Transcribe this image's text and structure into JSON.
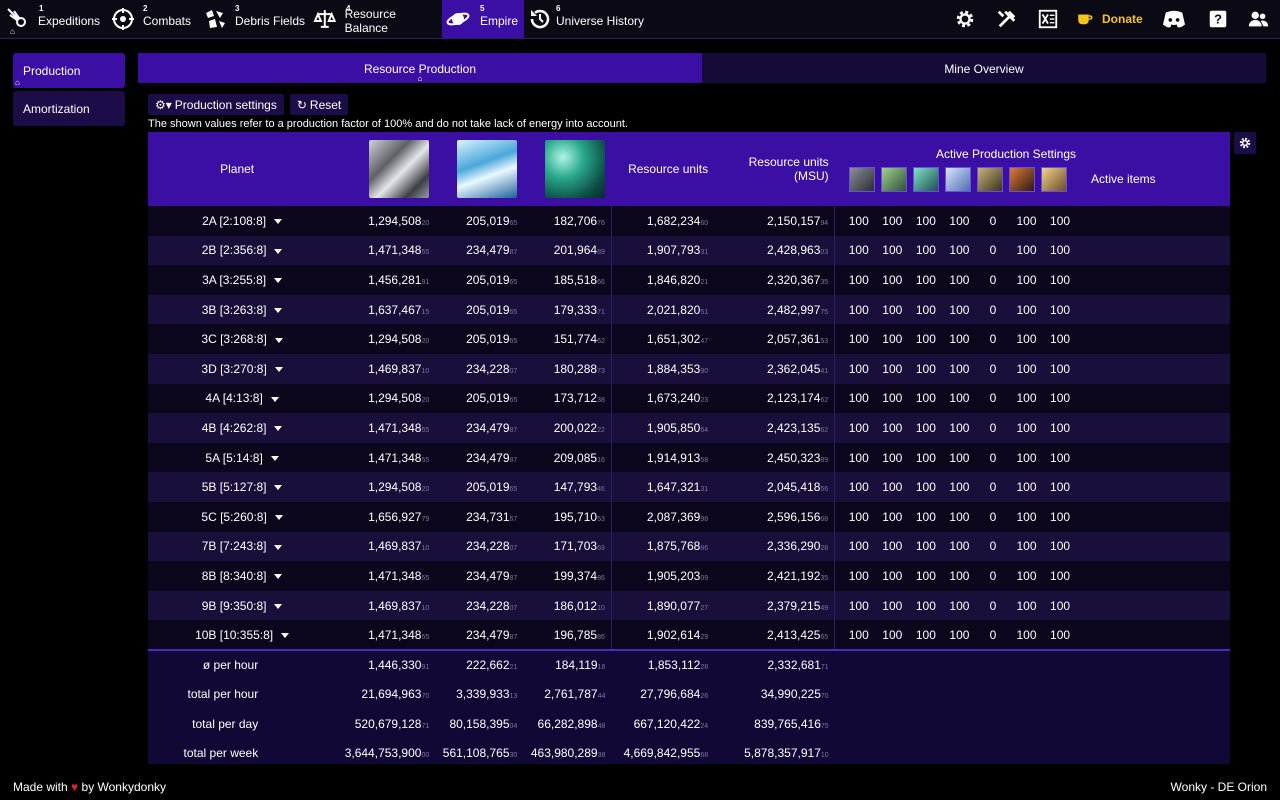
{
  "nav": [
    {
      "num": "1",
      "label": "Expeditions",
      "icon": "comet-icon"
    },
    {
      "num": "2",
      "label": "Combats",
      "icon": "crosshair-icon"
    },
    {
      "num": "3",
      "label": "Debris Fields",
      "icon": "debris-icon"
    },
    {
      "num": "4",
      "label": "Resource Balance",
      "icon": "scale-icon"
    },
    {
      "num": "5",
      "label": "Empire",
      "icon": "planet-icon"
    },
    {
      "num": "6",
      "label": "Universe History",
      "icon": "history-icon"
    }
  ],
  "top_right": {
    "donate_label": "Donate"
  },
  "sidebar": [
    {
      "label": "Production"
    },
    {
      "label": "Amortization"
    }
  ],
  "tabs": [
    {
      "label": "Resource Production"
    },
    {
      "label": "Mine Overview"
    }
  ],
  "toolbar": {
    "settings_label": "Production settings",
    "reset_label": "Reset"
  },
  "note": "The shown values refer to a production factor of 100% and do not take lack of energy into account.",
  "headers": {
    "planet": "Planet",
    "resource_units": "Resource units",
    "resource_units_msu": "Resource units (MSU)",
    "active_production_settings": "Active Production Settings",
    "active_items": "Active items"
  },
  "rows": [
    {
      "planet": "2A [2:108:8]",
      "metal": "1,294,508",
      "metal_dec": "20",
      "crystal": "205,019",
      "crystal_dec": "65",
      "deut": "182,706",
      "deut_dec": "76",
      "ru": "1,682,234",
      "ru_dec": "60",
      "msu": "2,150,157",
      "msu_dec": "94",
      "settings": [
        "100",
        "100",
        "100",
        "100",
        "0",
        "100",
        "100"
      ]
    },
    {
      "planet": "2B [2:356:8]",
      "metal": "1,471,348",
      "metal_dec": "55",
      "crystal": "234,479",
      "crystal_dec": "87",
      "deut": "201,964",
      "deut_dec": "89",
      "ru": "1,907,793",
      "ru_dec": "31",
      "msu": "2,428,963",
      "msu_dec": "03",
      "settings": [
        "100",
        "100",
        "100",
        "100",
        "0",
        "100",
        "100"
      ]
    },
    {
      "planet": "3A [3:255:8]",
      "metal": "1,456,281",
      "metal_dec": "91",
      "crystal": "205,019",
      "crystal_dec": "65",
      "deut": "185,518",
      "deut_dec": "66",
      "ru": "1,846,820",
      "ru_dec": "21",
      "msu": "2,320,367",
      "msu_dec": "35",
      "settings": [
        "100",
        "100",
        "100",
        "100",
        "0",
        "100",
        "100"
      ]
    },
    {
      "planet": "3B [3:263:8]",
      "metal": "1,637,467",
      "metal_dec": "15",
      "crystal": "205,019",
      "crystal_dec": "65",
      "deut": "179,333",
      "deut_dec": "71",
      "ru": "2,021,820",
      "ru_dec": "51",
      "msu": "2,482,997",
      "msu_dec": "75",
      "settings": [
        "100",
        "100",
        "100",
        "100",
        "0",
        "100",
        "100"
      ]
    },
    {
      "planet": "3C [3:268:8]",
      "metal": "1,294,508",
      "metal_dec": "20",
      "crystal": "205,019",
      "crystal_dec": "65",
      "deut": "151,774",
      "deut_dec": "62",
      "ru": "1,651,302",
      "ru_dec": "47",
      "msu": "2,057,361",
      "msu_dec": "53",
      "settings": [
        "100",
        "100",
        "100",
        "100",
        "0",
        "100",
        "100"
      ]
    },
    {
      "planet": "3D [3:270:8]",
      "metal": "1,469,837",
      "metal_dec": "10",
      "crystal": "234,228",
      "crystal_dec": "07",
      "deut": "180,288",
      "deut_dec": "73",
      "ru": "1,884,353",
      "ru_dec": "90",
      "msu": "2,362,045",
      "msu_dec": "41",
      "settings": [
        "100",
        "100",
        "100",
        "100",
        "0",
        "100",
        "100"
      ]
    },
    {
      "planet": "4A [4:13:8]",
      "metal": "1,294,508",
      "metal_dec": "20",
      "crystal": "205,019",
      "crystal_dec": "65",
      "deut": "173,712",
      "deut_dec": "38",
      "ru": "1,673,240",
      "ru_dec": "23",
      "msu": "2,123,174",
      "msu_dec": "62",
      "settings": [
        "100",
        "100",
        "100",
        "100",
        "0",
        "100",
        "100"
      ]
    },
    {
      "planet": "4B [4:262:8]",
      "metal": "1,471,348",
      "metal_dec": "55",
      "crystal": "234,479",
      "crystal_dec": "87",
      "deut": "200,022",
      "deut_dec": "22",
      "ru": "1,905,850",
      "ru_dec": "64",
      "msu": "2,423,135",
      "msu_dec": "62",
      "settings": [
        "100",
        "100",
        "100",
        "100",
        "0",
        "100",
        "100"
      ]
    },
    {
      "planet": "5A [5:14:8]",
      "metal": "1,471,348",
      "metal_dec": "55",
      "crystal": "234,479",
      "crystal_dec": "87",
      "deut": "209,085",
      "deut_dec": "16",
      "ru": "1,914,913",
      "ru_dec": "58",
      "msu": "2,450,323",
      "msu_dec": "89",
      "settings": [
        "100",
        "100",
        "100",
        "100",
        "0",
        "100",
        "100"
      ]
    },
    {
      "planet": "5B [5:127:8]",
      "metal": "1,294,508",
      "metal_dec": "20",
      "crystal": "205,019",
      "crystal_dec": "65",
      "deut": "147,793",
      "deut_dec": "46",
      "ru": "1,647,321",
      "ru_dec": "31",
      "msu": "2,045,418",
      "msu_dec": "56",
      "settings": [
        "100",
        "100",
        "100",
        "100",
        "0",
        "100",
        "100"
      ]
    },
    {
      "planet": "5C [5:260:8]",
      "metal": "1,656,927",
      "metal_dec": "79",
      "crystal": "234,731",
      "crystal_dec": "67",
      "deut": "195,710",
      "deut_dec": "53",
      "ru": "2,087,369",
      "ru_dec": "98",
      "msu": "2,596,156",
      "msu_dec": "68",
      "settings": [
        "100",
        "100",
        "100",
        "100",
        "0",
        "100",
        "100"
      ]
    },
    {
      "planet": "7B [7:243:8]",
      "metal": "1,469,837",
      "metal_dec": "10",
      "crystal": "234,228",
      "crystal_dec": "07",
      "deut": "171,703",
      "deut_dec": "69",
      "ru": "1,875,768",
      "ru_dec": "86",
      "msu": "2,336,290",
      "msu_dec": "28",
      "settings": [
        "100",
        "100",
        "100",
        "100",
        "0",
        "100",
        "100"
      ]
    },
    {
      "planet": "8B [8:340:8]",
      "metal": "1,471,348",
      "metal_dec": "55",
      "crystal": "234,479",
      "crystal_dec": "87",
      "deut": "199,374",
      "deut_dec": "86",
      "ru": "1,905,203",
      "ru_dec": "09",
      "msu": "2,421,192",
      "msu_dec": "35",
      "settings": [
        "100",
        "100",
        "100",
        "100",
        "0",
        "100",
        "100"
      ]
    },
    {
      "planet": "9B [9:350:8]",
      "metal": "1,469,837",
      "metal_dec": "10",
      "crystal": "234,228",
      "crystal_dec": "07",
      "deut": "186,012",
      "deut_dec": "10",
      "ru": "1,890,077",
      "ru_dec": "27",
      "msu": "2,379,215",
      "msu_dec": "49",
      "settings": [
        "100",
        "100",
        "100",
        "100",
        "0",
        "100",
        "100"
      ]
    },
    {
      "planet": "10B [10:355:8]",
      "metal": "1,471,348",
      "metal_dec": "55",
      "crystal": "234,479",
      "crystal_dec": "87",
      "deut": "196,785",
      "deut_dec": "86",
      "ru": "1,902,614",
      "ru_dec": "29",
      "msu": "2,413,425",
      "msu_dec": "65",
      "settings": [
        "100",
        "100",
        "100",
        "100",
        "0",
        "100",
        "100"
      ]
    }
  ],
  "totals": [
    {
      "label": "ø per hour",
      "metal": "1,446,330",
      "metal_dec": "91",
      "crystal": "222,662",
      "crystal_dec": "21",
      "deut": "184,119",
      "deut_dec": "16",
      "ru": "1,853,112",
      "ru_dec": "28",
      "msu": "2,332,681",
      "msu_dec": "71"
    },
    {
      "label": "total per hour",
      "metal": "21,694,963",
      "metal_dec": "70",
      "crystal": "3,339,933",
      "crystal_dec": "13",
      "deut": "2,761,787",
      "deut_dec": "44",
      "ru": "27,796,684",
      "ru_dec": "26",
      "msu": "34,990,225",
      "msu_dec": "70"
    },
    {
      "label": "total per day",
      "metal": "520,679,128",
      "metal_dec": "71",
      "crystal": "80,158,395",
      "crystal_dec": "04",
      "deut": "66,282,898",
      "deut_dec": "48",
      "ru": "667,120,422",
      "ru_dec": "24",
      "msu": "839,765,416",
      "msu_dec": "75"
    },
    {
      "label": "total per week",
      "metal": "3,644,753,900",
      "metal_dec": "00",
      "crystal": "561,108,765",
      "crystal_dec": "30",
      "deut": "463,980,289",
      "deut_dec": "38",
      "ru": "4,669,842,955",
      "ru_dec": "68",
      "msu": "5,878,357,917",
      "msu_dec": "10"
    }
  ],
  "footer": {
    "made_with": "Made with",
    "by": "by Wonkydonky",
    "right": "Wonky - DE Orion"
  },
  "colors": {
    "accent": "#3b0fa3",
    "panel": "#120835",
    "donate": "#f5c518",
    "heart": "#e02424"
  }
}
